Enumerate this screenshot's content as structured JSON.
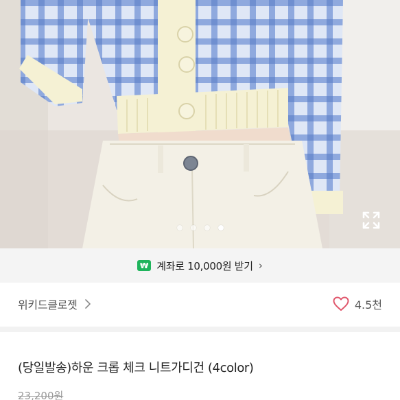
{
  "carousel": {
    "dot_count": 4,
    "active_index": 3
  },
  "promo": {
    "badge": "₩",
    "text": "계좌로 10,000원 받기",
    "chevron": "›",
    "badge_color": "#1fb45c"
  },
  "shop": {
    "name": "위키드클로젯",
    "likes": "4.5천",
    "heart_color": "#e0566b"
  },
  "product": {
    "title": "(당일발송)하운 크롭 체크 니트가디건 (4color)",
    "price": "23,200원"
  },
  "icons": {
    "expand": "expand-icon",
    "heart": "heart-icon",
    "chevron": "chevron-right-icon"
  }
}
